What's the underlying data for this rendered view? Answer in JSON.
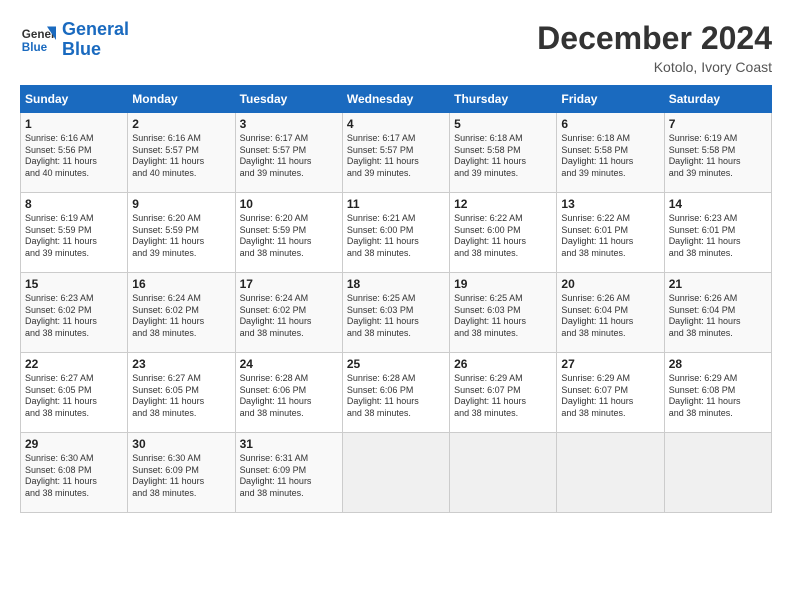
{
  "header": {
    "logo_line1": "General",
    "logo_line2": "Blue",
    "month": "December 2024",
    "location": "Kotolo, Ivory Coast"
  },
  "weekdays": [
    "Sunday",
    "Monday",
    "Tuesday",
    "Wednesday",
    "Thursday",
    "Friday",
    "Saturday"
  ],
  "weeks": [
    [
      {
        "day": "1",
        "info": "Sunrise: 6:16 AM\nSunset: 5:56 PM\nDaylight: 11 hours\nand 40 minutes."
      },
      {
        "day": "2",
        "info": "Sunrise: 6:16 AM\nSunset: 5:57 PM\nDaylight: 11 hours\nand 40 minutes."
      },
      {
        "day": "3",
        "info": "Sunrise: 6:17 AM\nSunset: 5:57 PM\nDaylight: 11 hours\nand 39 minutes."
      },
      {
        "day": "4",
        "info": "Sunrise: 6:17 AM\nSunset: 5:57 PM\nDaylight: 11 hours\nand 39 minutes."
      },
      {
        "day": "5",
        "info": "Sunrise: 6:18 AM\nSunset: 5:58 PM\nDaylight: 11 hours\nand 39 minutes."
      },
      {
        "day": "6",
        "info": "Sunrise: 6:18 AM\nSunset: 5:58 PM\nDaylight: 11 hours\nand 39 minutes."
      },
      {
        "day": "7",
        "info": "Sunrise: 6:19 AM\nSunset: 5:58 PM\nDaylight: 11 hours\nand 39 minutes."
      }
    ],
    [
      {
        "day": "8",
        "info": "Sunrise: 6:19 AM\nSunset: 5:59 PM\nDaylight: 11 hours\nand 39 minutes."
      },
      {
        "day": "9",
        "info": "Sunrise: 6:20 AM\nSunset: 5:59 PM\nDaylight: 11 hours\nand 39 minutes."
      },
      {
        "day": "10",
        "info": "Sunrise: 6:20 AM\nSunset: 5:59 PM\nDaylight: 11 hours\nand 38 minutes."
      },
      {
        "day": "11",
        "info": "Sunrise: 6:21 AM\nSunset: 6:00 PM\nDaylight: 11 hours\nand 38 minutes."
      },
      {
        "day": "12",
        "info": "Sunrise: 6:22 AM\nSunset: 6:00 PM\nDaylight: 11 hours\nand 38 minutes."
      },
      {
        "day": "13",
        "info": "Sunrise: 6:22 AM\nSunset: 6:01 PM\nDaylight: 11 hours\nand 38 minutes."
      },
      {
        "day": "14",
        "info": "Sunrise: 6:23 AM\nSunset: 6:01 PM\nDaylight: 11 hours\nand 38 minutes."
      }
    ],
    [
      {
        "day": "15",
        "info": "Sunrise: 6:23 AM\nSunset: 6:02 PM\nDaylight: 11 hours\nand 38 minutes."
      },
      {
        "day": "16",
        "info": "Sunrise: 6:24 AM\nSunset: 6:02 PM\nDaylight: 11 hours\nand 38 minutes."
      },
      {
        "day": "17",
        "info": "Sunrise: 6:24 AM\nSunset: 6:02 PM\nDaylight: 11 hours\nand 38 minutes."
      },
      {
        "day": "18",
        "info": "Sunrise: 6:25 AM\nSunset: 6:03 PM\nDaylight: 11 hours\nand 38 minutes."
      },
      {
        "day": "19",
        "info": "Sunrise: 6:25 AM\nSunset: 6:03 PM\nDaylight: 11 hours\nand 38 minutes."
      },
      {
        "day": "20",
        "info": "Sunrise: 6:26 AM\nSunset: 6:04 PM\nDaylight: 11 hours\nand 38 minutes."
      },
      {
        "day": "21",
        "info": "Sunrise: 6:26 AM\nSunset: 6:04 PM\nDaylight: 11 hours\nand 38 minutes."
      }
    ],
    [
      {
        "day": "22",
        "info": "Sunrise: 6:27 AM\nSunset: 6:05 PM\nDaylight: 11 hours\nand 38 minutes."
      },
      {
        "day": "23",
        "info": "Sunrise: 6:27 AM\nSunset: 6:05 PM\nDaylight: 11 hours\nand 38 minutes."
      },
      {
        "day": "24",
        "info": "Sunrise: 6:28 AM\nSunset: 6:06 PM\nDaylight: 11 hours\nand 38 minutes."
      },
      {
        "day": "25",
        "info": "Sunrise: 6:28 AM\nSunset: 6:06 PM\nDaylight: 11 hours\nand 38 minutes."
      },
      {
        "day": "26",
        "info": "Sunrise: 6:29 AM\nSunset: 6:07 PM\nDaylight: 11 hours\nand 38 minutes."
      },
      {
        "day": "27",
        "info": "Sunrise: 6:29 AM\nSunset: 6:07 PM\nDaylight: 11 hours\nand 38 minutes."
      },
      {
        "day": "28",
        "info": "Sunrise: 6:29 AM\nSunset: 6:08 PM\nDaylight: 11 hours\nand 38 minutes."
      }
    ],
    [
      {
        "day": "29",
        "info": "Sunrise: 6:30 AM\nSunset: 6:08 PM\nDaylight: 11 hours\nand 38 minutes."
      },
      {
        "day": "30",
        "info": "Sunrise: 6:30 AM\nSunset: 6:09 PM\nDaylight: 11 hours\nand 38 minutes."
      },
      {
        "day": "31",
        "info": "Sunrise: 6:31 AM\nSunset: 6:09 PM\nDaylight: 11 hours\nand 38 minutes."
      },
      {
        "day": "",
        "info": ""
      },
      {
        "day": "",
        "info": ""
      },
      {
        "day": "",
        "info": ""
      },
      {
        "day": "",
        "info": ""
      }
    ]
  ]
}
